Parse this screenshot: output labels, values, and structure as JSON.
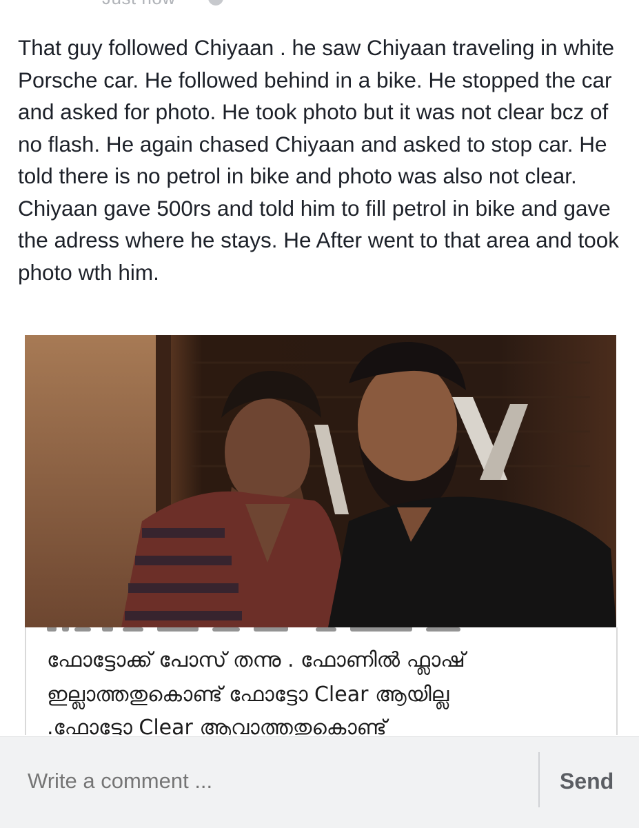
{
  "post": {
    "timestamp": "Just now",
    "text": "That guy followed Chiyaan . he saw Chiyaan traveling in white Porsche car. He followed behind in a bike. He stopped the car and asked for photo. He took photo but it was not clear bcz of no flash. He again chased Chiyaan and asked to stop car. He told there is no petrol in bike and photo was also not clear. Chiyaan gave 500rs and told him to fill petrol in bike and gave the adress where he stays. He After went to that area and took photo wth him."
  },
  "caption": {
    "line1": "ഫോട്ടോക്ക് പോസ് തന്നു . ഫോണിൽ ഫ്ലാഷ്",
    "line2": "ഇല്ലാത്തതുകൊണ്ട് ഫോട്ടോ Clear ആയില്ല",
    "line3": ".ഫോട്ടോ Clear ആവാത്തതുകൊണ്ട്"
  },
  "comment": {
    "placeholder": "Write a comment ...",
    "send_label": "Send"
  },
  "colors": {
    "text": "#1d2129",
    "placeholder": "#9ea2a8",
    "comment_bar_bg": "#f1f2f3",
    "send": "#5b5e63"
  }
}
